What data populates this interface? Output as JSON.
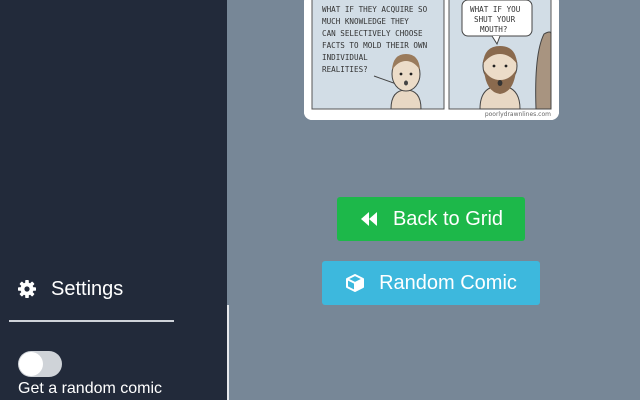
{
  "comic": {
    "panel1_text": [
      "WHAT IF THEY ACQUIRE SO",
      "MUCH KNOWLEDGE THEY",
      "CAN SELECTIVELY CHOOSE",
      "FACTS TO MOLD THEIR OWN",
      "INDIVIDUAL",
      "REALITIES?"
    ],
    "panel2_text": [
      "WHAT IF YOU",
      "SHUT YOUR",
      "MOUTH?"
    ],
    "credit": "poorlydrawnlines.com"
  },
  "buttons": {
    "back_label": "Back to Grid",
    "random_label": "Random Comic"
  },
  "sidebar": {
    "settings_label": "Settings",
    "toggle_label": "Get a random comic",
    "toggle_on": false
  },
  "icons": {
    "settings": "gear-icon",
    "back": "backward-icon",
    "random": "cube-icon"
  },
  "colors": {
    "green": "#1db84a",
    "blue": "#3db8dd",
    "sidebar": "#222a3a",
    "background": "#778797"
  }
}
